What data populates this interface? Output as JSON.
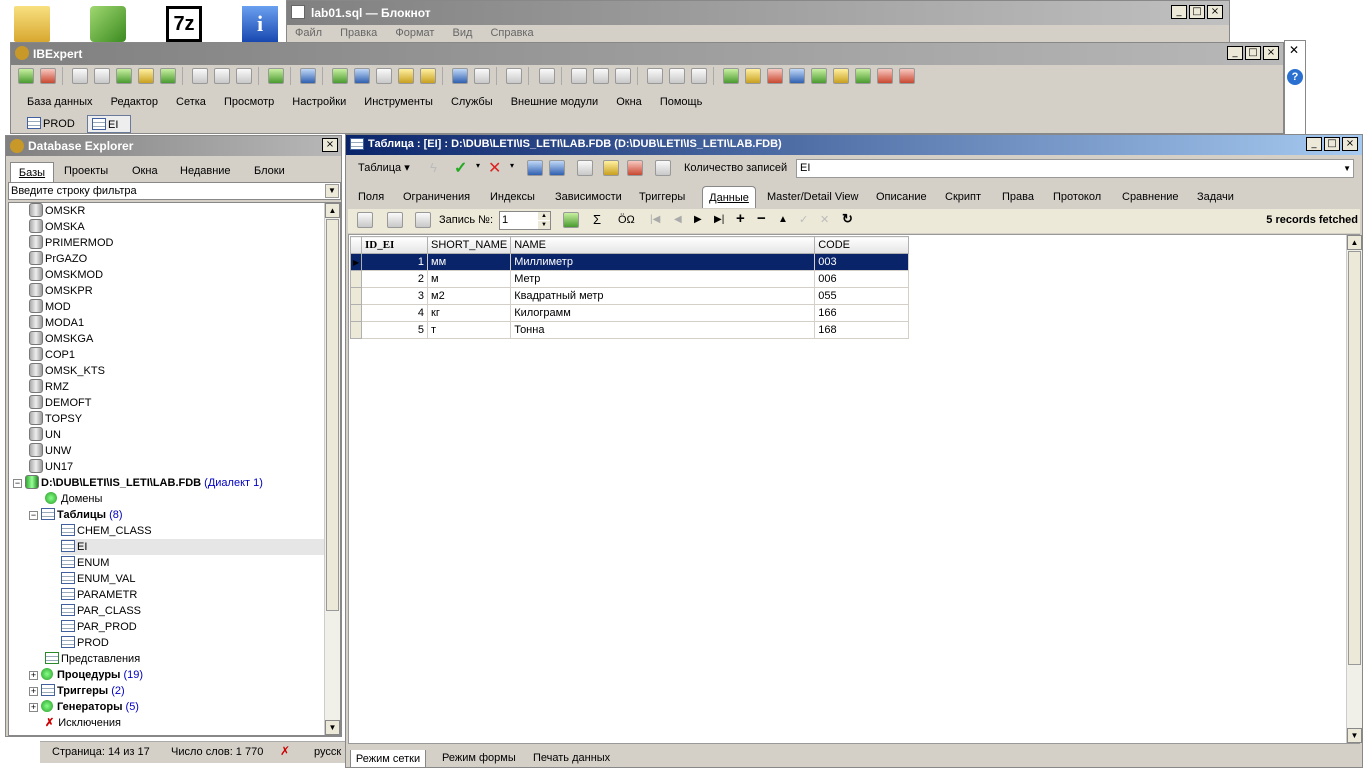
{
  "notepad": {
    "title": "lab01.sql — Блокнот",
    "menu": [
      "Файл",
      "Правка",
      "Формат",
      "Вид",
      "Справка"
    ]
  },
  "ibexpert": {
    "title": "IBExpert",
    "menu": [
      "База данных",
      "Редактор",
      "Сетка",
      "Просмотр",
      "Настройки",
      "Инструменты",
      "Службы",
      "Внешние модули",
      "Окна",
      "Помощь"
    ],
    "window_tabs": [
      "PROD",
      "EI"
    ]
  },
  "db_explorer": {
    "title": "Database Explorer",
    "tabs": [
      "Базы",
      "Проекты",
      "Окна",
      "Недавние",
      "Блоки"
    ],
    "filter_placeholder": "Введите строку фильтра",
    "databases": [
      "OMSKR",
      "OMSKA",
      "PRIMERMOD",
      "PrGAZO",
      "OMSKMOD",
      "OMSKPR",
      "MOD",
      "MODA1",
      "OMSKGA",
      "COP1",
      "OMSK_KTS",
      "RMZ",
      "DEMOFT",
      "TOPSY",
      "UN",
      "UNW",
      "UN17"
    ],
    "active_db": {
      "path": "D:\\DUB\\LETI\\IS_LETI\\LAB.FDB",
      "dialect": "(Диалект 1)"
    },
    "domains": "Домены",
    "tables": {
      "label": "Таблицы",
      "count": "(8)",
      "items": [
        "CHEM_CLASS",
        "EI",
        "ENUM",
        "ENUM_VAL",
        "PARAMETR",
        "PAR_CLASS",
        "PAR_PROD",
        "PROD"
      ]
    },
    "views": "Представления",
    "procedures": {
      "label": "Процедуры",
      "count": "(19)"
    },
    "triggers": {
      "label": "Триггеры",
      "count": "(2)"
    },
    "generators": {
      "label": "Генераторы",
      "count": "(5)"
    },
    "exceptions": "Исключения"
  },
  "table_window": {
    "title": "Таблица : [EI] : D:\\DUB\\LETI\\IS_LETI\\LAB.FDB (D:\\DUB\\LETI\\IS_LETI\\LAB.FDB)",
    "table_menu": "Таблица",
    "record_count_label": "Количество записей",
    "table_name": "EI",
    "tabs": [
      "Поля",
      "Ограничения",
      "Индексы",
      "Зависимости",
      "Триггеры",
      "Данные",
      "Master/Detail View",
      "Описание",
      "Скрипт",
      "Права",
      "Протокол",
      "Сравнение",
      "Задачи"
    ],
    "active_tab": "Данные",
    "record_label": "Запись №:",
    "record_value": "1",
    "records_fetched": "5 records fetched",
    "columns": [
      "ID_EI",
      "SHORT_NAME",
      "NAME",
      "CODE"
    ],
    "rows": [
      [
        "1",
        "мм",
        "Миллиметр",
        "003"
      ],
      [
        "2",
        "м",
        "Метр",
        "006"
      ],
      [
        "3",
        "м2",
        "Квадратный метр",
        "055"
      ],
      [
        "4",
        "кг",
        "Килограмм",
        "166"
      ],
      [
        "5",
        "т",
        "Тонна",
        "168"
      ]
    ],
    "bottom_tabs": [
      "Режим сетки",
      "Режим формы",
      "Печать данных"
    ]
  },
  "word_status": {
    "page": "Страница: 14 из 17",
    "words": "Число слов: 1 770",
    "lang": "русск"
  }
}
